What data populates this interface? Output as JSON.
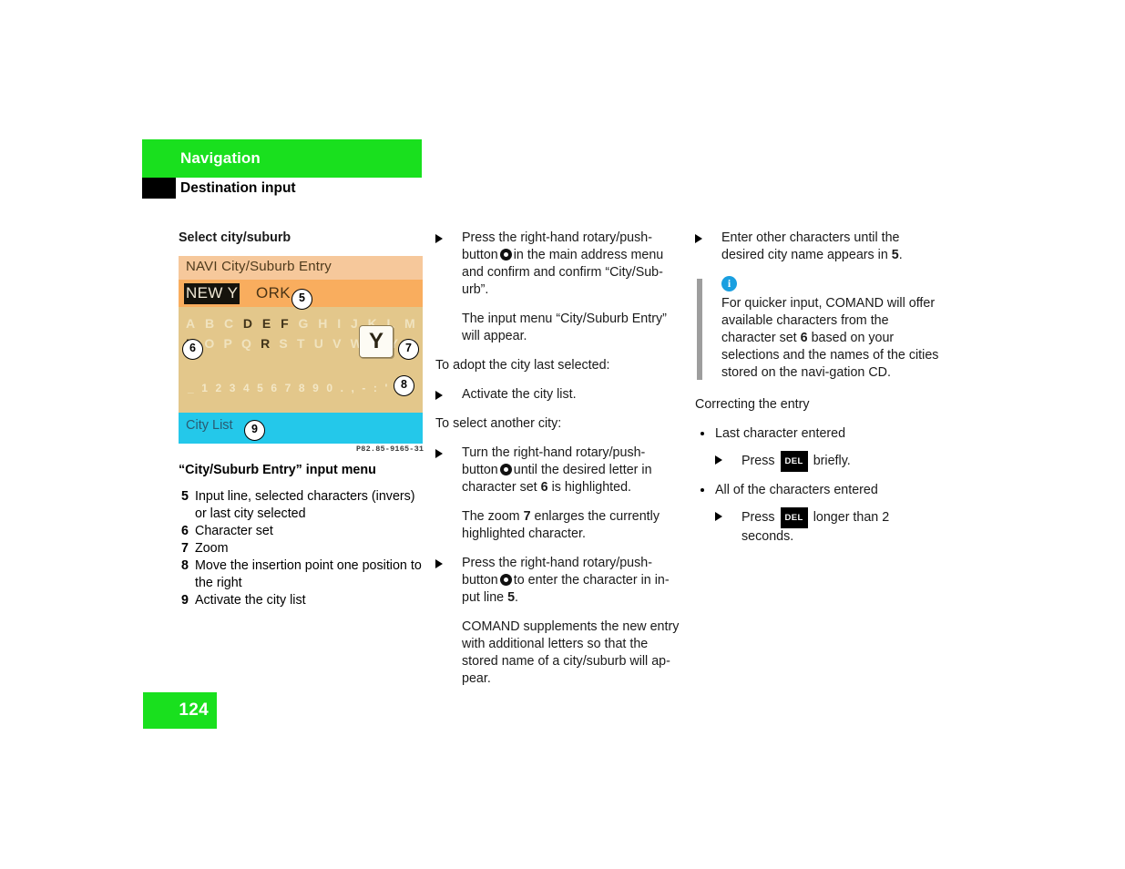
{
  "header": {
    "section": "Navigation",
    "subsection": "Destination input"
  },
  "page": {
    "number": "124"
  },
  "left_column": {
    "heading": "Select city/suburb",
    "figure": {
      "screen_title": "NAVI City/Suburb Entry",
      "input_inverse": "NEW Y",
      "input_rest": "ORK",
      "char_row_1": [
        "A",
        "B",
        "C",
        "D",
        "E",
        "F",
        "G",
        "H",
        "I",
        "J",
        "K",
        "L",
        "M"
      ],
      "char_row_1_state": [
        "off",
        "off",
        "off",
        "on",
        "on",
        "on",
        "off",
        "off",
        "off",
        "off",
        "off",
        "off",
        "off"
      ],
      "char_row_2": [
        "N",
        "O",
        "P",
        "Q",
        "R",
        "S",
        "T",
        "U",
        "V",
        "W",
        "X",
        "Y",
        "Z"
      ],
      "char_row_2_state": [
        "on",
        "off",
        "off",
        "off",
        "on",
        "off",
        "off",
        "off",
        "off",
        "off",
        "off",
        "off",
        "off"
      ],
      "num_row": [
        "_",
        "1",
        "2",
        "3",
        "4",
        "5",
        "6",
        "7",
        "8",
        "9",
        "0",
        ".",
        ",",
        "-",
        ":",
        "'",
        "/"
      ],
      "zoom_char": "Y",
      "insert_arrow": "➡",
      "city_list_label": "City List",
      "callouts": [
        "5",
        "6",
        "7",
        "8",
        "9"
      ],
      "figure_code": "P82.85-9165-31"
    },
    "figure_caption": "“City/Suburb Entry” input menu",
    "legend": [
      {
        "n": "5",
        "text": "Input line, selected characters (invers) or last city selected"
      },
      {
        "n": "6",
        "text": "Character set"
      },
      {
        "n": "7",
        "text": "Zoom"
      },
      {
        "n": "8",
        "text": "Move the insertion point one position to the right"
      },
      {
        "n": "9",
        "text": "Activate the city list"
      }
    ]
  },
  "middle_column": {
    "step1_a": "Press the right-hand rotary/push-button",
    "step1_b": "in the main address menu and confirm and confirm “City/Sub-urb”.",
    "step1_result": "The input menu “City/Suburb Entry” will appear.",
    "lead_adopt": "To adopt the city last selected:",
    "step2": "Activate the city list.",
    "lead_another": "To select another city:",
    "step3_a": "Turn the right-hand rotary/push-button",
    "step3_b": "until the desired letter in character set",
    "step3_num": "6",
    "step3_c": "is highlighted.",
    "step3_result_a": "The zoom",
    "step3_result_num": "7",
    "step3_result_b": "enlarges the currently highlighted character.",
    "step4_a": "Press the right-hand rotary/push-button",
    "step4_b": "to enter the character in in-put line",
    "step4_num": "5",
    "step4_c": ".",
    "step4_result": "COMAND supplements the new entry with additional letters so that the stored name of a city/suburb will ap-pear."
  },
  "right_column": {
    "step5_a": "Enter other characters until the desired city name appears in",
    "step5_num": "5",
    "step5_b": ".",
    "note_icon": "i",
    "note_a": "For quicker input, COMAND will offer available characters from the character set",
    "note_num": "6",
    "note_b": "based on your selections and the names of the cities stored on the navi-gation CD.",
    "correct_heading": "Correcting the entry",
    "bullet1": "Last character entered",
    "bullet1_action_a": "Press",
    "bullet1_key": "DEL",
    "bullet1_action_b": "briefly.",
    "bullet2": "All of the characters entered",
    "bullet2_action_a": "Press",
    "bullet2_key": "DEL",
    "bullet2_action_b": "longer than 2 seconds."
  },
  "colors": {
    "brand_green": "#19e01e",
    "cyan_bar": "#24c8ea",
    "info_blue": "#1a9fe0",
    "screen_tan": "#e3c78b",
    "screen_orange": "#f9ad5e"
  }
}
